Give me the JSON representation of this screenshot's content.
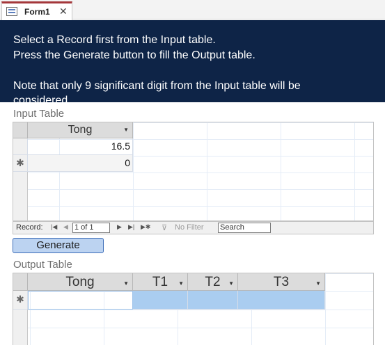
{
  "tab": {
    "label": "Form1",
    "icon": "form-icon",
    "close": "✕"
  },
  "header": {
    "line1": "Select a Record first from the Input table.",
    "line2": "Press the Generate button to fill the Output table.",
    "line3": "Note that only 9 significant digit from the Input table will be",
    "line4": "considered."
  },
  "input_table": {
    "label": "Input Table",
    "columns": [
      "Tong"
    ],
    "rows": [
      {
        "selector": "",
        "Tong": "16.5"
      },
      {
        "selector": "✱",
        "Tong": "0"
      }
    ]
  },
  "navigation": {
    "record_label": "Record:",
    "position": "1 of 1",
    "filter_label": "No Filter",
    "search_placeholder": "Search"
  },
  "generate_button": {
    "label": "Generate"
  },
  "output_table": {
    "label": "Output Table",
    "columns": [
      "Tong",
      "T1",
      "T2",
      "T3"
    ],
    "rows": [
      {
        "selector": "✱",
        "Tong": "",
        "T1": "",
        "T2": "",
        "T3": ""
      }
    ]
  },
  "colors": {
    "header_bg": "#0e2447",
    "tab_accent": "#a4373a",
    "button_bg": "#bcd3f1",
    "selection": "#aacdf0"
  }
}
